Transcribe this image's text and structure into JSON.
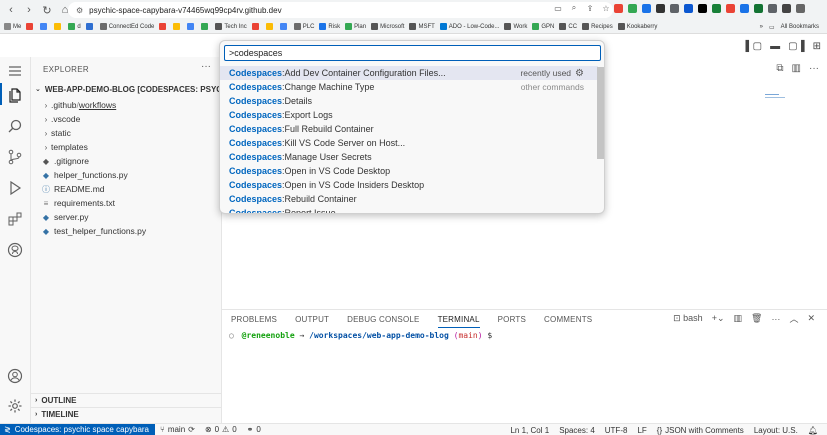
{
  "browser": {
    "url": "psychic-space-capybara-v74465wq99cp4rv.github.dev",
    "bookmarks": [
      {
        "label": "Me",
        "color": "#888888"
      },
      {
        "label": "",
        "color": "#ea4335"
      },
      {
        "label": "",
        "color": "#4285f4"
      },
      {
        "label": "",
        "color": "#fbbc05"
      },
      {
        "label": "d",
        "color": "#34a853"
      },
      {
        "label": "",
        "color": "#2f6fd1"
      },
      {
        "label": "ConnectEd Code",
        "color": "#6b6b6b"
      },
      {
        "label": "",
        "color": "#ea4335"
      },
      {
        "label": "",
        "color": "#fbbc05"
      },
      {
        "label": "",
        "color": "#4285f4"
      },
      {
        "label": "",
        "color": "#34a853"
      },
      {
        "label": "Tech Inc",
        "color": "#555555"
      },
      {
        "label": "",
        "color": "#ea4335"
      },
      {
        "label": "",
        "color": "#fbbc05"
      },
      {
        "label": "",
        "color": "#4285f4"
      },
      {
        "label": "PLC",
        "color": "#6b6b6b"
      },
      {
        "label": "Risk",
        "color": "#1a73e8"
      },
      {
        "label": "Plan",
        "color": "#34a853"
      },
      {
        "label": "Microsoft",
        "color": "#555555"
      },
      {
        "label": "MSFT",
        "color": "#555555"
      },
      {
        "label": "ADO - Low-Code...",
        "color": "#0078d4"
      },
      {
        "label": "Work",
        "color": "#555555"
      },
      {
        "label": "GPN",
        "color": "#34a853"
      },
      {
        "label": "CC",
        "color": "#555555"
      },
      {
        "label": "Recipes",
        "color": "#555555"
      },
      {
        "label": "Kookaberry",
        "color": "#555555"
      }
    ],
    "all_bookmarks": "All Bookmarks",
    "ext_colors": [
      "#ea4335",
      "#34a853",
      "#1a73e8",
      "#333333",
      "#5f6368",
      "#0b57d0",
      "#000000",
      "#188038",
      "#ea4335",
      "#1a73e8",
      "#137333",
      "#5f6368",
      "#444444",
      "#666666"
    ]
  },
  "sidebar": {
    "title": "EXPLORER",
    "more": "···",
    "workspace": "WEB-APP-DEMO-BLOG [CODESPACES: PSYCHI...",
    "items": [
      {
        "type": "folder",
        "name": ".github",
        "sub": "workflows"
      },
      {
        "type": "folder",
        "name": ".vscode"
      },
      {
        "type": "folder",
        "name": "static"
      },
      {
        "type": "folder",
        "name": "templates"
      },
      {
        "type": "file",
        "name": ".gitignore",
        "icon": "◆",
        "color": "#555555"
      },
      {
        "type": "file",
        "name": "helper_functions.py",
        "icon": "◆",
        "color": "#3572a5"
      },
      {
        "type": "file",
        "name": "README.md",
        "icon": "ⓘ",
        "color": "#3572a5"
      },
      {
        "type": "file",
        "name": "requirements.txt",
        "icon": "≡",
        "color": "#777777"
      },
      {
        "type": "file",
        "name": "server.py",
        "icon": "◆",
        "color": "#3572a5"
      },
      {
        "type": "file",
        "name": "test_helper_functions.py",
        "icon": "◆",
        "color": "#3572a5"
      }
    ],
    "outline": "OUTLINE",
    "timeline": "TIMELINE"
  },
  "palette": {
    "query": ">codespaces",
    "items": [
      {
        "cat": "Codespaces",
        "label": "Add Dev Container Configuration Files...",
        "right": "recently used",
        "gear": true
      },
      {
        "cat": "Codespaces",
        "label": "Change Machine Type",
        "right": "other commands"
      },
      {
        "cat": "Codespaces",
        "label": "Details"
      },
      {
        "cat": "Codespaces",
        "label": "Export Logs"
      },
      {
        "cat": "Codespaces",
        "label": "Full Rebuild Container"
      },
      {
        "cat": "Codespaces",
        "label": "Kill VS Code Server on Host..."
      },
      {
        "cat": "Codespaces",
        "label": "Manage User Secrets"
      },
      {
        "cat": "Codespaces",
        "label": "Open in VS Code Desktop"
      },
      {
        "cat": "Codespaces",
        "label": "Open in VS Code Insiders Desktop"
      },
      {
        "cat": "Codespaces",
        "label": "Rebuild Container"
      },
      {
        "cat": "Codespaces",
        "label": "Report Issue"
      }
    ]
  },
  "panel": {
    "tabs": [
      "PROBLEMS",
      "OUTPUT",
      "DEBUG CONSOLE",
      "TERMINAL",
      "PORTS",
      "COMMENTS"
    ],
    "active_tab": "TERMINAL",
    "shell": "bash",
    "terminal": {
      "user": "@reneenoble",
      "arrow": "→",
      "path": "/workspaces/web-app-demo-blog",
      "branch_open": "(",
      "branch": "main",
      "branch_close": ")",
      "prompt": "$"
    }
  },
  "status": {
    "remote": "Codespaces: psychic space capybara",
    "branch": "main",
    "errors": "0",
    "warnings": "0",
    "ports": "0",
    "position": "Ln 1, Col 1",
    "spaces": "Spaces: 4",
    "encoding": "UTF-8",
    "eol": "LF",
    "language": "JSON with Comments",
    "layout": "Layout: U.S."
  }
}
